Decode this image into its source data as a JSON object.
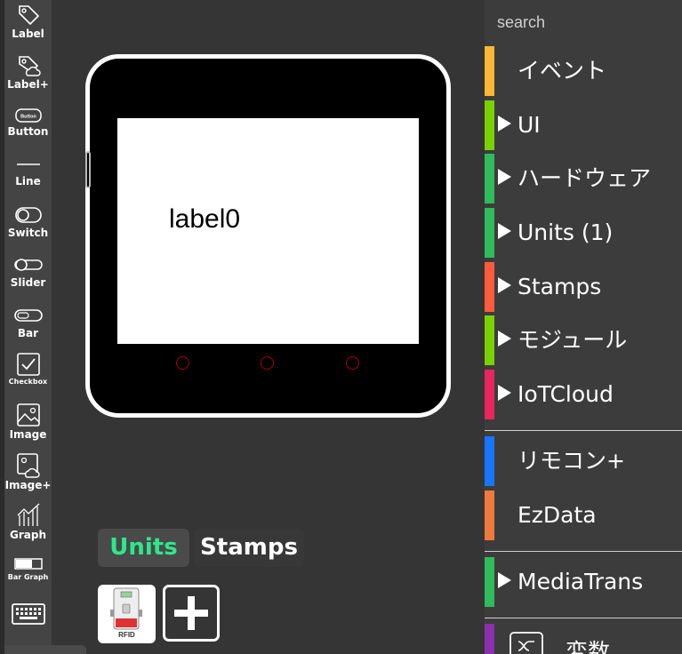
{
  "palette": {
    "items": [
      {
        "label": "Label",
        "icon": "tag-icon"
      },
      {
        "label": "Label+",
        "icon": "tag-cloud-icon"
      },
      {
        "label": "Button",
        "icon": "button-icon",
        "inner": "Button"
      },
      {
        "label": "Line",
        "icon": "line-icon"
      },
      {
        "label": "Switch",
        "icon": "switch-icon"
      },
      {
        "label": "Slider",
        "icon": "slider-icon"
      },
      {
        "label": "Bar",
        "icon": "bar-icon"
      },
      {
        "label": "Checkbox",
        "icon": "checkbox-icon"
      },
      {
        "label": "Image",
        "icon": "image-icon"
      },
      {
        "label": "Image+",
        "icon": "image-cloud-icon"
      },
      {
        "label": "Graph",
        "icon": "graph-icon"
      },
      {
        "label": "Bar Graph",
        "icon": "bar-graph-icon"
      },
      {
        "label": "",
        "icon": "keyboard-icon"
      }
    ]
  },
  "device": {
    "label": "label0"
  },
  "tabs": {
    "units": "Units",
    "stamps": "Stamps"
  },
  "units": {
    "rfid": "RFID"
  },
  "sidebar": {
    "search_placeholder": "search",
    "categories": [
      {
        "label": "イベント",
        "color": "#ffb733",
        "expandable": false
      },
      {
        "label": "UI",
        "color": "#7ad100",
        "expandable": true
      },
      {
        "label": "ハードウェア",
        "color": "#2ebc5c",
        "expandable": true
      },
      {
        "label": "Units (1)",
        "color": "#2ebc5c",
        "expandable": true
      },
      {
        "label": "Stamps",
        "color": "#ff5a3c",
        "expandable": true
      },
      {
        "label": "モジュール",
        "color": "#7ad100",
        "expandable": true
      },
      {
        "label": "IoTCloud",
        "color": "#e8255c",
        "expandable": true
      },
      {
        "label": "リモコン+",
        "color": "#1776ff",
        "expandable": false
      },
      {
        "label": "EzData",
        "color": "#f07a3c",
        "expandable": false
      },
      {
        "label": "MediaTrans",
        "color": "#2ebc5c",
        "expandable": true
      },
      {
        "label": "変数",
        "color": "#8a2fb0",
        "expandable": false
      }
    ]
  }
}
